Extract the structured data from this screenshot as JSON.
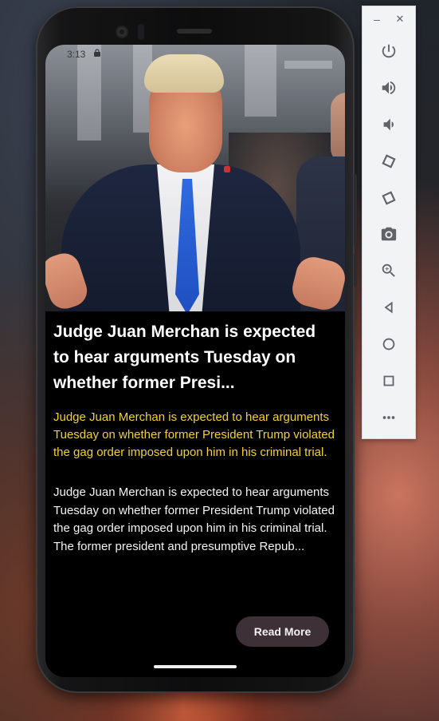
{
  "status_bar": {
    "time": "3:13"
  },
  "article": {
    "headline": "Judge Juan Merchan is expected to hear arguments Tuesday on whether former Presi...",
    "summary": "Judge Juan Merchan is expected to hear arguments Tuesday on whether former President Trump violated the gag order imposed upon him in his criminal trial.",
    "body_line1": "Judge Juan Merchan is expected to hear arguments Tuesday on whether former President Trump violated the gag order imposed upon him in his criminal trial.",
    "body_line2": "The former president and presumptive Repub...",
    "read_more_label": "Read More"
  },
  "emulator": {
    "minimize_glyph": "–",
    "close_glyph": "✕",
    "buttons": [
      {
        "icon": "power-icon"
      },
      {
        "icon": "volume-up-icon"
      },
      {
        "icon": "volume-down-icon"
      },
      {
        "icon": "rotate-left-icon"
      },
      {
        "icon": "rotate-right-icon"
      },
      {
        "icon": "camera-icon"
      },
      {
        "icon": "zoom-icon"
      },
      {
        "icon": "back-icon"
      },
      {
        "icon": "home-icon"
      },
      {
        "icon": "overview-icon"
      },
      {
        "icon": "more-icon"
      }
    ]
  },
  "colors": {
    "summary_text": "#f2d13a",
    "button_bg": "#3d3036",
    "screen_bg": "#000000",
    "panel_bg": "#f1f3f4"
  }
}
